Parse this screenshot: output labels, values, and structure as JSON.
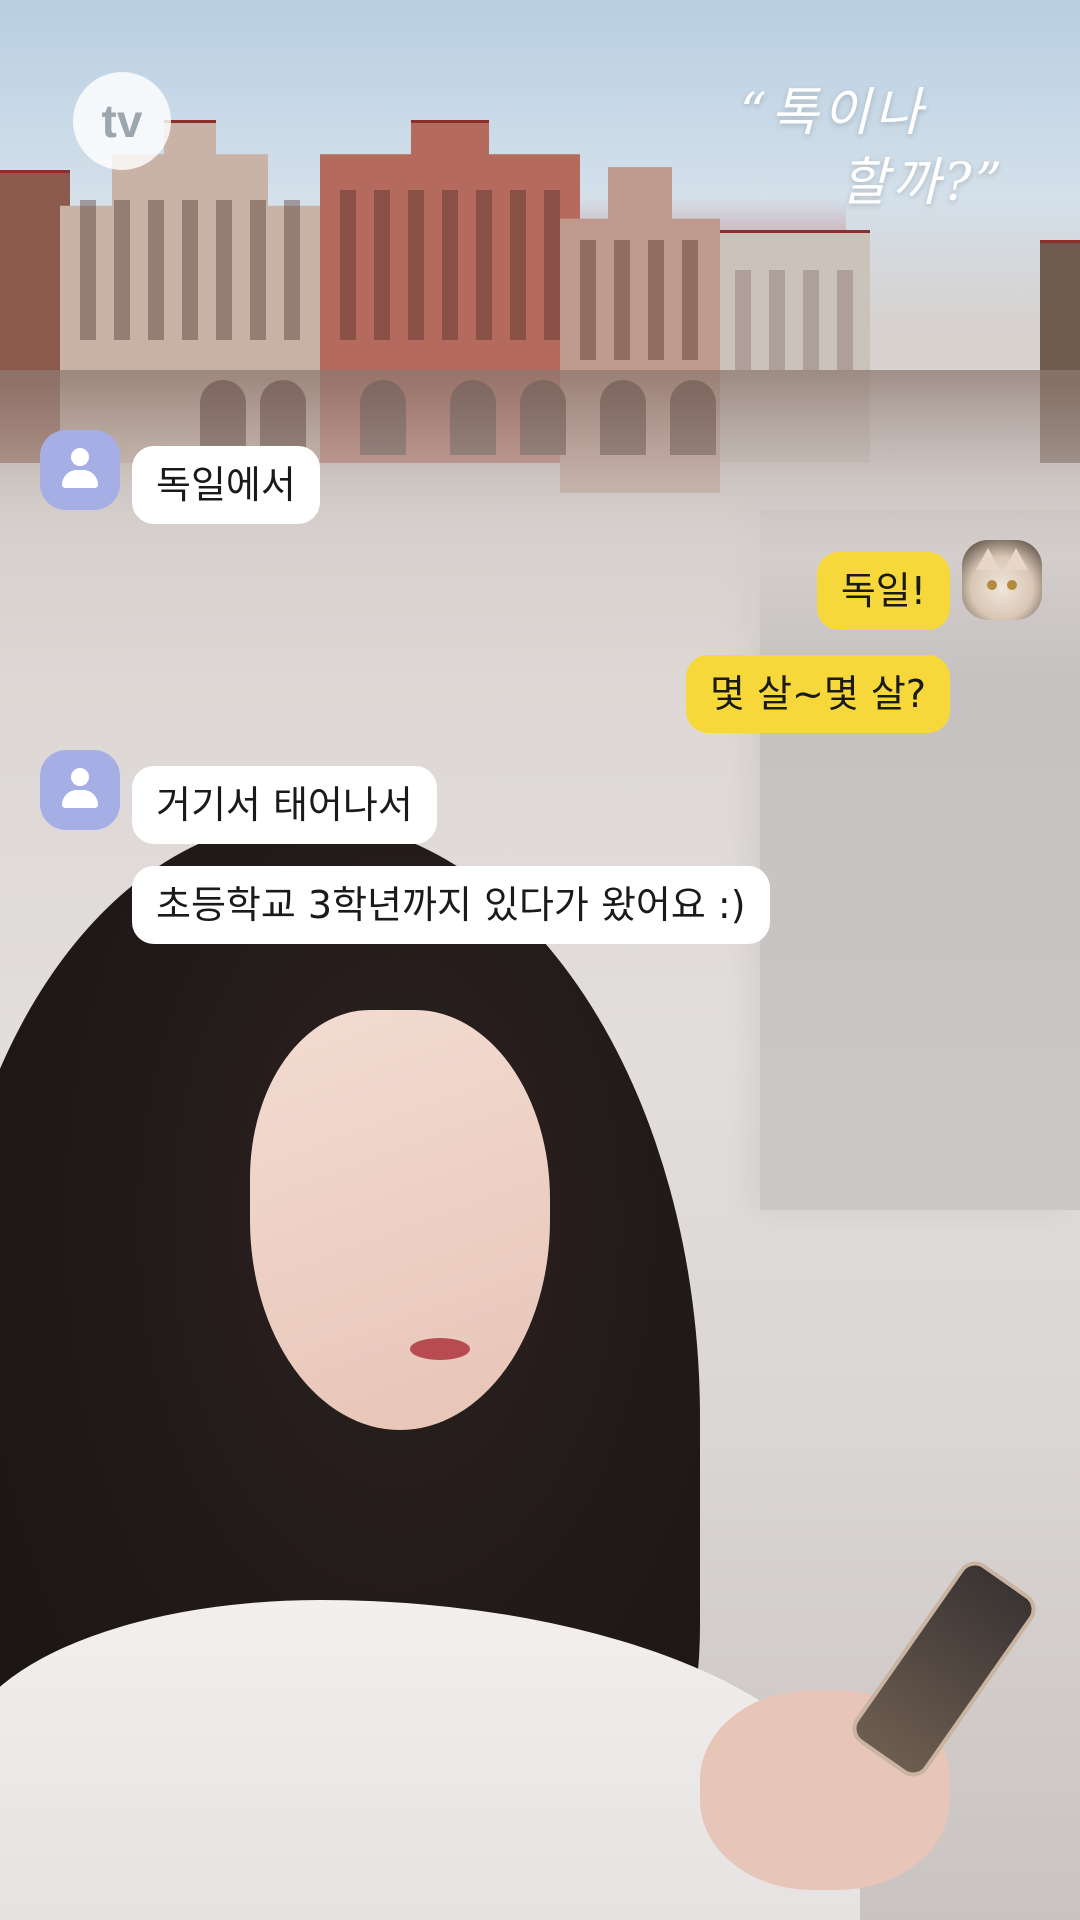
{
  "overlay": {
    "logo_text": "tv",
    "title_line1": "“톡이나",
    "title_line2": "할까?”"
  },
  "chat": {
    "messages": [
      {
        "sender": "other",
        "text": "독일에서"
      },
      {
        "sender": "me",
        "text": "독일!"
      },
      {
        "sender": "me",
        "text": "몇 살~몇 살?"
      },
      {
        "sender": "other",
        "text": "거기서 태어나서"
      },
      {
        "sender": "other",
        "text": "초등학교 3학년까지 있다가 왔어요 :)"
      }
    ],
    "colors": {
      "incoming_bubble": "#ffffff",
      "outgoing_bubble": "#f7d83a",
      "default_avatar": "#a6afe5"
    }
  },
  "icons": {
    "other_avatar": "person-icon",
    "my_avatar": "cat-photo-avatar"
  }
}
